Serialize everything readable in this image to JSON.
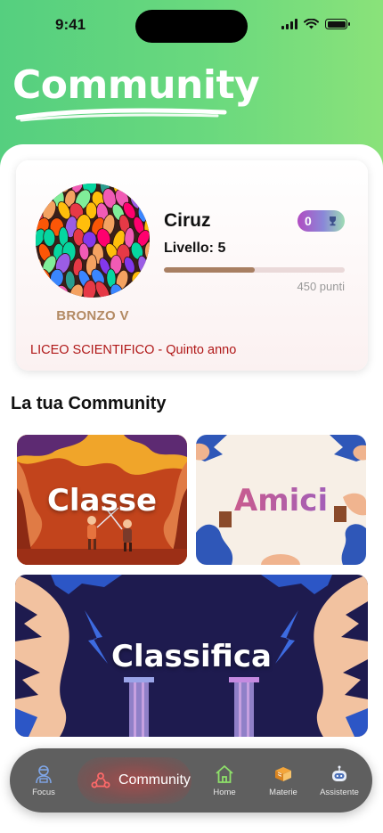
{
  "status_bar": {
    "time": "9:41"
  },
  "header": {
    "title": "Community"
  },
  "profile": {
    "name": "Ciruz",
    "level_text": "Livello: 5",
    "trophies": "0",
    "progress_fraction": 0.5,
    "points_text": "450 punti",
    "rank": "BRONZO V",
    "school": "LICEO SCIENTIFICO - Quinto anno"
  },
  "section": {
    "title": "La tua Community"
  },
  "tiles": {
    "classe": "Classe",
    "amici": "Amici",
    "classifica": "Classifica"
  },
  "tabbar": {
    "focus": "Focus",
    "community": "Community",
    "home": "Home",
    "materie": "Materie",
    "assistente": "Assistente"
  },
  "colors": {
    "header_green": "#6ad97e",
    "rank_color": "#b38a63",
    "school_red": "#b01818",
    "tabbar_bg": "#5f5f5f",
    "progress_fill": "#a87f62"
  },
  "icons": [
    "wifi-icon",
    "battery-icon",
    "signal-icon",
    "trophy-icon",
    "focus-icon",
    "community-icon",
    "home-icon",
    "materie-icon",
    "assistente-icon"
  ]
}
